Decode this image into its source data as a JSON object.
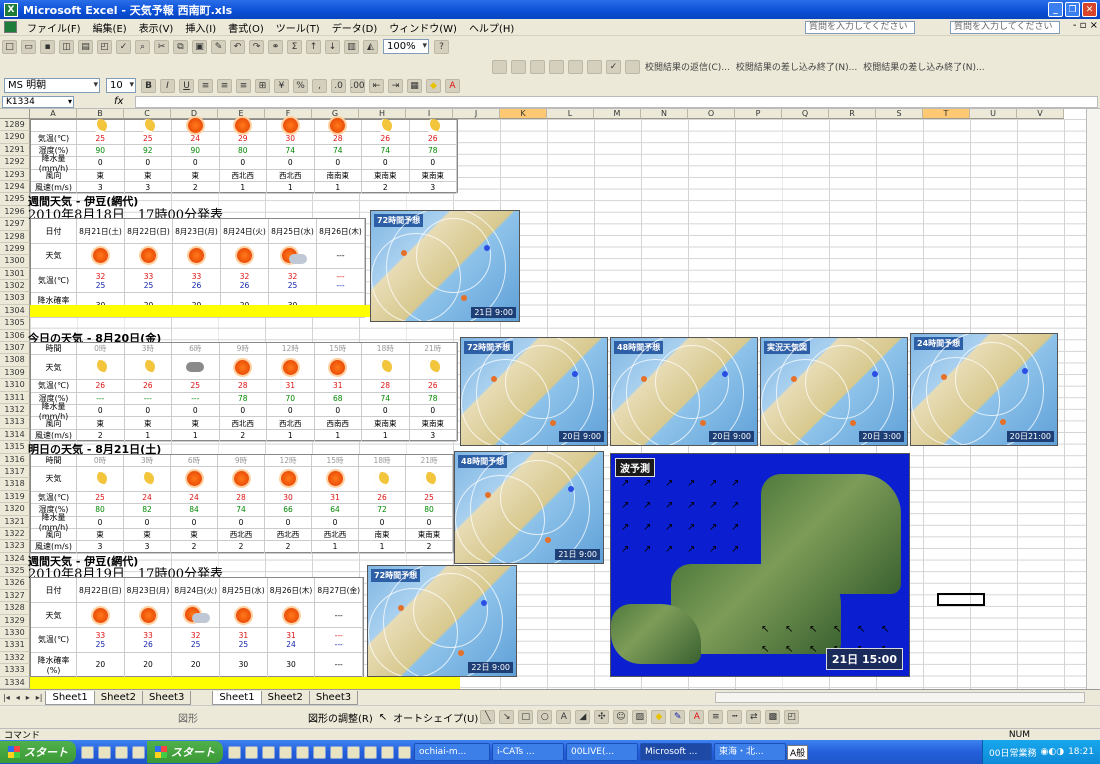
{
  "window": {
    "title": "Microsoft Excel - 天気予報 西南町.xls"
  },
  "menu": [
    "ファイル(F)",
    "編集(E)",
    "表示(V)",
    "挿入(I)",
    "書式(O)",
    "ツール(T)",
    "データ(D)",
    "ウィンドウ(W)",
    "ヘルプ(H)"
  ],
  "help_placeholder": "質問を入力してください",
  "toolbar": {
    "zoom": "100%",
    "font": "MS 明朝",
    "size": "10",
    "review": [
      "校閲結果の返信(C)...",
      "校閲結果の差し込み終了(N)...",
      "校閲結果の差し込み終了(N)..."
    ]
  },
  "namebox": "K1334",
  "fx": "fx",
  "columns": [
    "A",
    "B",
    "C",
    "D",
    "E",
    "F",
    "G",
    "H",
    "I",
    "J",
    "K",
    "L",
    "M",
    "N",
    "O",
    "P",
    "Q",
    "R",
    "S",
    "T",
    "U",
    "V"
  ],
  "rows": [
    "1289",
    "1290",
    "1291",
    "1292",
    "1293",
    "1294",
    "1295",
    "1296",
    "1297",
    "1298",
    "1299",
    "1300",
    "1301",
    "1302",
    "1303",
    "1304",
    "1305",
    "1306",
    "1307",
    "1308",
    "1309",
    "1310",
    "1311",
    "1312",
    "1313",
    "1314",
    "1315",
    "1316",
    "1317",
    "1318",
    "1319",
    "1320",
    "1321",
    "1322",
    "1323",
    "1324",
    "1325",
    "1326",
    "1327",
    "1328",
    "1329",
    "1330",
    "1331",
    "1332",
    "1333",
    "1334"
  ],
  "block_top": {
    "rows": [
      {
        "label": "気温(℃)",
        "cells": [
          "25",
          "25",
          "24",
          "29",
          "30",
          "28",
          "26",
          "26"
        ],
        "color": "red"
      },
      {
        "label": "湿度(%)",
        "cells": [
          "90",
          "92",
          "90",
          "80",
          "74",
          "74",
          "74",
          "78"
        ],
        "color": "green"
      },
      {
        "label": "降水量(mm/h)",
        "cells": [
          "0",
          "0",
          "0",
          "0",
          "0",
          "0",
          "0",
          "0"
        ],
        "color": ""
      },
      {
        "label": "風向",
        "cells": [
          "東",
          "東",
          "東",
          "西北西",
          "西北西",
          "南南東",
          "東南東",
          "東南東"
        ],
        "color": ""
      },
      {
        "label": "風速(m/s)",
        "cells": [
          "3",
          "3",
          "2",
          "1",
          "1",
          "1",
          "2",
          "3"
        ],
        "color": ""
      }
    ]
  },
  "weekly1": {
    "title": "週間天気 - 伊豆(網代)",
    "date": "2010年8月18日　17時00分発表",
    "header_label": "日付",
    "dates": [
      "8月21日(土)",
      "8月22日(日)",
      "8月23日(月)",
      "8月24日(火)",
      "8月25日(水)",
      "8月26日(木)"
    ],
    "weather_label": "天気",
    "temp_label": "気温(℃)",
    "highs": [
      "32",
      "33",
      "33",
      "32",
      "32",
      "---"
    ],
    "lows": [
      "25",
      "25",
      "26",
      "26",
      "25",
      "---"
    ],
    "rain_label": "降水確率(%)",
    "rain": [
      "30",
      "20",
      "20",
      "20",
      "30",
      "---"
    ]
  },
  "today": {
    "title": "今日の天気 - 8月20日(金)",
    "time_label": "時間",
    "times": [
      "0時",
      "3時",
      "6時",
      "9時",
      "12時",
      "15時",
      "18時",
      "21時"
    ],
    "weather_label": "天気",
    "temp_label": "気温(℃)",
    "temps": [
      "26",
      "26",
      "25",
      "28",
      "31",
      "31",
      "28",
      "26"
    ],
    "humid_label": "湿度(%)",
    "humid": [
      "---",
      "---",
      "---",
      "78",
      "70",
      "68",
      "74",
      "78"
    ],
    "precip_label": "降水量(mm/h)",
    "precip": [
      "0",
      "0",
      "0",
      "0",
      "0",
      "0",
      "0",
      "0"
    ],
    "wdir_label": "風向",
    "wdir": [
      "東",
      "東",
      "東",
      "西北西",
      "西北西",
      "西南西",
      "東南東",
      "東南東"
    ],
    "wspd_label": "風速(m/s)",
    "wspd": [
      "2",
      "1",
      "1",
      "2",
      "1",
      "1",
      "1",
      "3"
    ]
  },
  "tomorrow": {
    "title": "明日の天気 - 8月21日(土)",
    "time_label": "時間",
    "times": [
      "0時",
      "3時",
      "6時",
      "9時",
      "12時",
      "15時",
      "18時",
      "21時"
    ],
    "weather_label": "天気",
    "temp_label": "気温(℃)",
    "temps": [
      "25",
      "24",
      "24",
      "28",
      "30",
      "31",
      "26",
      "25"
    ],
    "humid_label": "湿度(%)",
    "humid": [
      "80",
      "82",
      "84",
      "74",
      "66",
      "64",
      "72",
      "80"
    ],
    "precip_label": "降水量(mm/h)",
    "precip": [
      "0",
      "0",
      "0",
      "0",
      "0",
      "0",
      "0",
      "0"
    ],
    "wdir_label": "風向",
    "wdir": [
      "東",
      "東",
      "東",
      "西北西",
      "西北西",
      "西北西",
      "南東",
      "東南東"
    ],
    "wspd_label": "風速(m/s)",
    "wspd": [
      "3",
      "3",
      "2",
      "2",
      "2",
      "1",
      "1",
      "2"
    ]
  },
  "weekly2": {
    "title": "週間天気 - 伊豆(網代)",
    "date": "2010年8月19日　17時00分発表",
    "header_label": "日付",
    "dates": [
      "8月22日(日)",
      "8月23日(月)",
      "8月24日(火)",
      "8月25日(水)",
      "8月26日(木)",
      "8月27日(金)"
    ],
    "weather_label": "天気",
    "temp_label": "気温(℃)",
    "highs": [
      "33",
      "33",
      "32",
      "31",
      "31",
      "---"
    ],
    "lows": [
      "25",
      "26",
      "25",
      "25",
      "24",
      "---"
    ],
    "rain_label": "降水確率(%)",
    "rain": [
      "20",
      "20",
      "20",
      "30",
      "30",
      "---"
    ]
  },
  "maps": [
    {
      "label": "72時間予想",
      "time": "21日 9:00"
    },
    {
      "label": "72時間予想",
      "time": "20日 9:00"
    },
    {
      "label": "48時間予想",
      "time": "20日 9:00"
    },
    {
      "label": "実況天気図",
      "time": "20日 3:00"
    },
    {
      "label": "24時間予想",
      "time": "20日21:00"
    },
    {
      "label": "48時間予想",
      "time": "21日 9:00"
    },
    {
      "label": "72時間予想",
      "time": "22日 9:00"
    }
  ],
  "wave": {
    "label": "波予測",
    "time": "21日 15:00"
  },
  "tabs": [
    "Sheet1",
    "Sheet2",
    "Sheet3",
    "Sheet1",
    "Sheet2",
    "Sheet3"
  ],
  "drawbar": {
    "shapes": "図形の調整(R)",
    "autoshape": "オートシェイプ(U)",
    "left": "図形"
  },
  "status": {
    "mode": "コマンド",
    "num": "NUM"
  },
  "taskbar": {
    "start": "スタート",
    "start2": "スタート",
    "tasks": [
      "ochiai-m...",
      "i-CATs ...",
      "00LIVE(...",
      "Microsoft ...",
      "東海・北..."
    ],
    "ime": "A般",
    "clock_label": "00日常業務",
    "time": "18:21"
  }
}
